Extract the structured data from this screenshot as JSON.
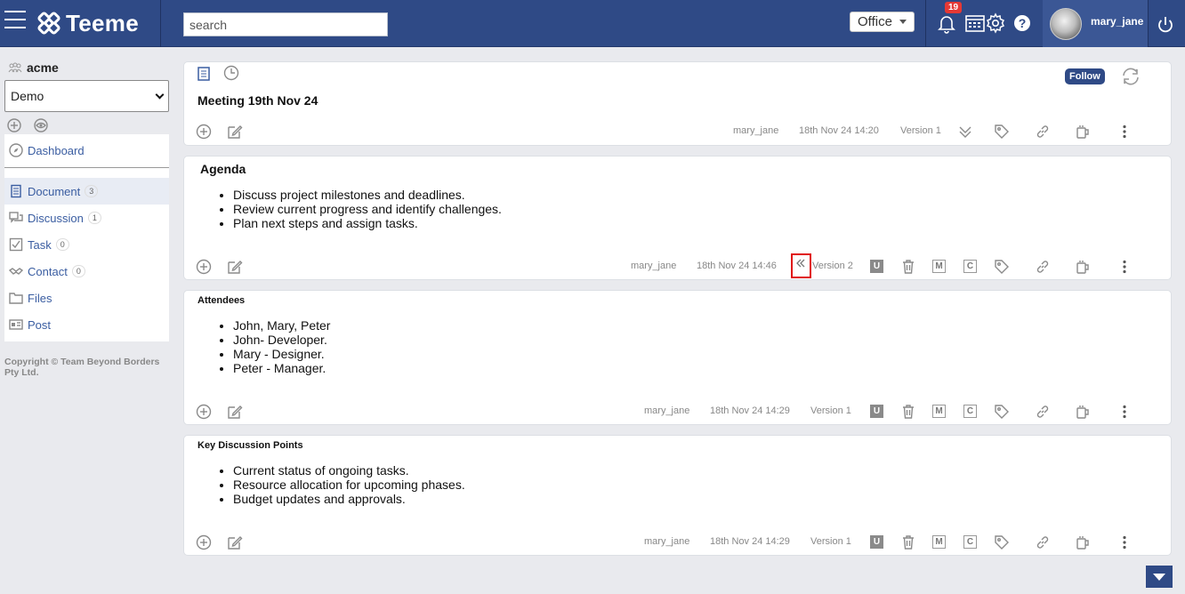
{
  "header": {
    "app_name": "Teeme",
    "search_placeholder": "search",
    "office_label": "Office",
    "notification_count": "19",
    "username": "mary_jane"
  },
  "sidebar": {
    "org_name": "acme",
    "workspace": "Demo",
    "items": [
      {
        "label": "Dashboard",
        "icon": "compass-icon",
        "count": ""
      },
      {
        "label": "Document",
        "icon": "document-icon",
        "count": "3"
      },
      {
        "label": "Discussion",
        "icon": "discussion-icon",
        "count": "1"
      },
      {
        "label": "Task",
        "icon": "checkbox-icon",
        "count": "0"
      },
      {
        "label": "Contact",
        "icon": "handshake-icon",
        "count": "0"
      },
      {
        "label": "Files",
        "icon": "folder-icon",
        "count": ""
      },
      {
        "label": "Post",
        "icon": "post-icon",
        "count": ""
      }
    ],
    "copyright": "Copyright © Team Beyond Borders Pty Ltd."
  },
  "document": {
    "title": "Meeting 19th Nov 24",
    "follow_label": "Follow",
    "author": "mary_jane",
    "timestamp": "18th Nov 24 14:20",
    "version": "Version 1"
  },
  "sections": [
    {
      "title": "Agenda",
      "bullets": [
        "Discuss project milestones and deadlines.",
        "Review current progress and identify challenges.",
        "Plan next steps and assign tasks."
      ],
      "author": "mary_jane",
      "timestamp": "18th Nov 24 14:46",
      "version": "Version 2"
    },
    {
      "title": "Attendees",
      "bullets": [
        "John, Mary, Peter",
        "John- Developer.",
        "Mary - Designer.",
        "Peter - Manager."
      ],
      "author": "mary_jane",
      "timestamp": "18th Nov 24 14:29",
      "version": "Version 1"
    },
    {
      "title": "Key Discussion Points",
      "bullets": [
        "Current status of ongoing tasks.",
        "Resource allocation for upcoming phases.",
        "Budget updates and approvals."
      ],
      "author": "mary_jane",
      "timestamp": "18th Nov 24 14:29",
      "version": "Version 1"
    }
  ],
  "badges": {
    "u": "U",
    "m": "M",
    "c": "C"
  },
  "colors": {
    "brand": "#2f4a86",
    "link": "#3a5da1",
    "highlight": "#e01010",
    "badge": "#e53935"
  }
}
